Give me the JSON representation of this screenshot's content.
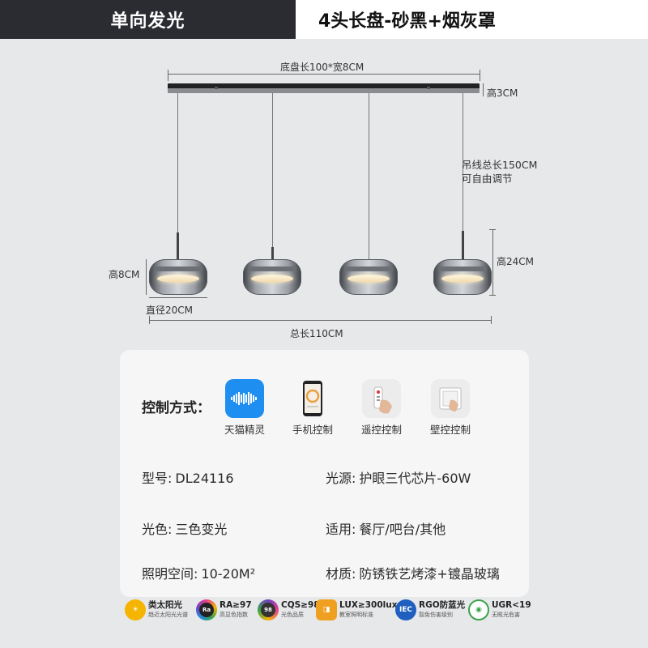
{
  "header": {
    "left_title": "单向发光",
    "right_title": "4头长盘-砂黑+烟灰罩"
  },
  "diagram": {
    "canopy_size": "底盘长100*宽8CM",
    "canopy_height": "高3CM",
    "wire_length_1": "吊线总长150CM",
    "wire_length_2": "可自由调节",
    "shade_height": "高8CM",
    "total_height": "高24CM",
    "diameter": "直径20CM",
    "total_length": "总长110CM"
  },
  "control": {
    "title": "控制方式：",
    "methods": [
      {
        "label": "天猫精灵",
        "icon": "tmall-genie-icon"
      },
      {
        "label": "手机控制",
        "icon": "smartphone-icon"
      },
      {
        "label": "遥控控制",
        "icon": "remote-control-icon"
      },
      {
        "label": "壁控控制",
        "icon": "wall-switch-icon"
      }
    ]
  },
  "specs": {
    "model_label": "型号:",
    "model_value": "DL24116",
    "source_label": "光源:",
    "source_value": "护眼三代芯片-60W",
    "color_label": "光色:",
    "color_value": "三色变光",
    "apply_label": "适用:",
    "apply_value": "餐厅/吧台/其他",
    "space_label": "照明空间:",
    "space_value": "10-20M²",
    "material_label": "材质:",
    "material_value": "防锈铁艺烤漆+镀晶玻璃"
  },
  "features": [
    {
      "title": "类太阳光",
      "sub": "趋近太阳光光谱",
      "icon": "sun-icon",
      "badge": "",
      "color": "#f4b400"
    },
    {
      "title": "RA≥97",
      "sub": "高显色指数",
      "icon": "ra-icon",
      "badge": "Ra",
      "color": "#e83e8c"
    },
    {
      "title": "CQS≥98",
      "sub": "光色品质",
      "icon": "cqs-icon",
      "badge": "98",
      "color": "#6f42c1"
    },
    {
      "title": "LUX≥300lux",
      "sub": "教室照明标准",
      "icon": "lux-icon",
      "badge": "",
      "color": "#f0a020"
    },
    {
      "title": "RGO防蓝光",
      "sub": "豁免伤害级别",
      "icon": "iec-icon",
      "badge": "IEC",
      "color": "#1f5fbf"
    },
    {
      "title": "UGR<19",
      "sub": "无眩光危害",
      "icon": "eye-icon",
      "badge": "",
      "color": "#3aa34a"
    }
  ]
}
